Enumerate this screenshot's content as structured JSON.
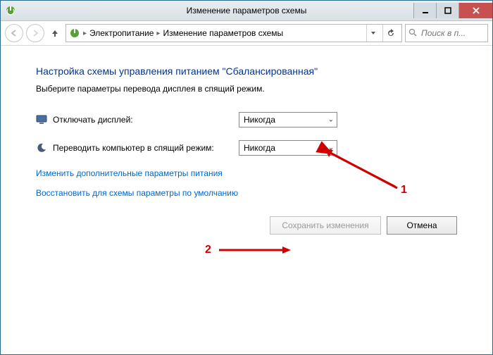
{
  "window": {
    "title": "Изменение параметров схемы"
  },
  "nav": {
    "breadcrumb": {
      "root": "Электропитание",
      "current": "Изменение параметров схемы"
    },
    "search_placeholder": "Поиск в п..."
  },
  "page": {
    "heading": "Настройка схемы управления питанием \"Сбалансированная\"",
    "subtitle": "Выберите параметры перевода дисплея в спящий режим."
  },
  "settings": {
    "display_off": {
      "label": "Отключать дисплей:",
      "value": "Никогда"
    },
    "sleep": {
      "label": "Переводить компьютер в спящий режим:",
      "value": "Никогда"
    }
  },
  "links": {
    "advanced": "Изменить дополнительные параметры питания",
    "restore_defaults": "Восстановить для схемы параметры по умолчанию"
  },
  "buttons": {
    "save": "Сохранить изменения",
    "cancel": "Отмена"
  },
  "annotations": {
    "n1": "1",
    "n2": "2"
  }
}
